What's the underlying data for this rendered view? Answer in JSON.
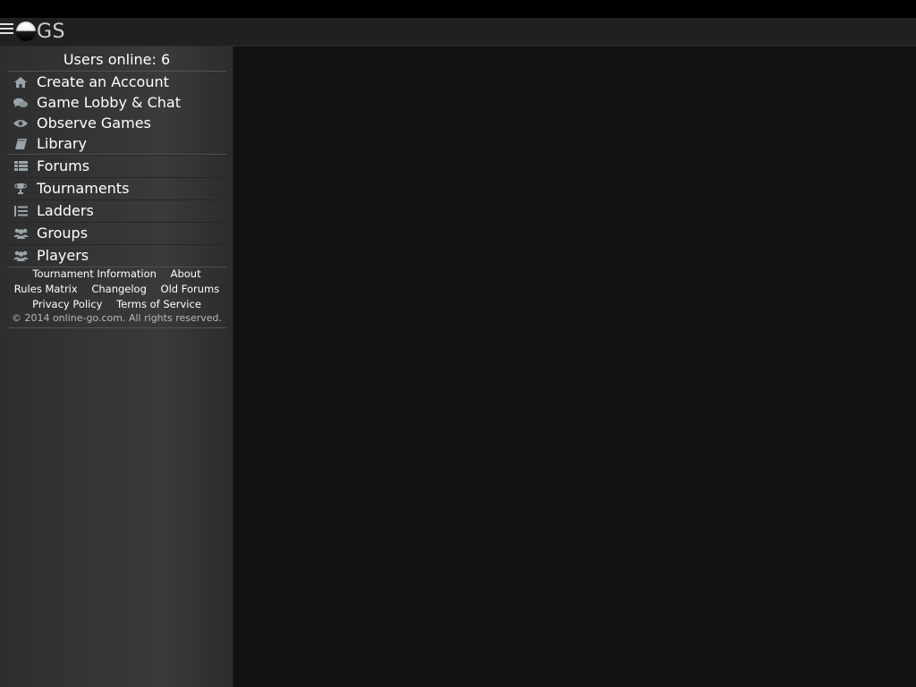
{
  "header": {
    "logo_text": "GS",
    "menu_icon": "hamburger-icon",
    "logo_icon": "go-stone-icon"
  },
  "sidebar": {
    "users_online": "Users online: 6",
    "primary_items": [
      {
        "label": "Create an Account",
        "icon": "home-icon"
      },
      {
        "label": "Game Lobby & Chat",
        "icon": "chat-bubbles-icon"
      },
      {
        "label": "Observe Games",
        "icon": "eye-icon"
      },
      {
        "label": "Library",
        "icon": "book-icon"
      }
    ],
    "secondary_items": [
      {
        "label": "Forums",
        "icon": "list-icon"
      },
      {
        "label": "Tournaments",
        "icon": "trophy-icon"
      },
      {
        "label": "Ladders",
        "icon": "ladder-list-icon"
      },
      {
        "label": "Groups",
        "icon": "group-icon"
      },
      {
        "label": "Players",
        "icon": "players-icon"
      }
    ],
    "footer_links": {
      "tournament_information": "Tournament Information",
      "about": "About",
      "rules_matrix": "Rules Matrix",
      "changelog": "Changelog",
      "old_forums": "Old Forums",
      "privacy_policy": "Privacy Policy",
      "terms_of_service": "Terms of Service"
    },
    "copyright": "© 2014 online-go.com. All rights reserved."
  },
  "colors": {
    "icon_color": "#9aa4aa",
    "sidebar_bg": "#353535",
    "main_bg": "#121212"
  }
}
